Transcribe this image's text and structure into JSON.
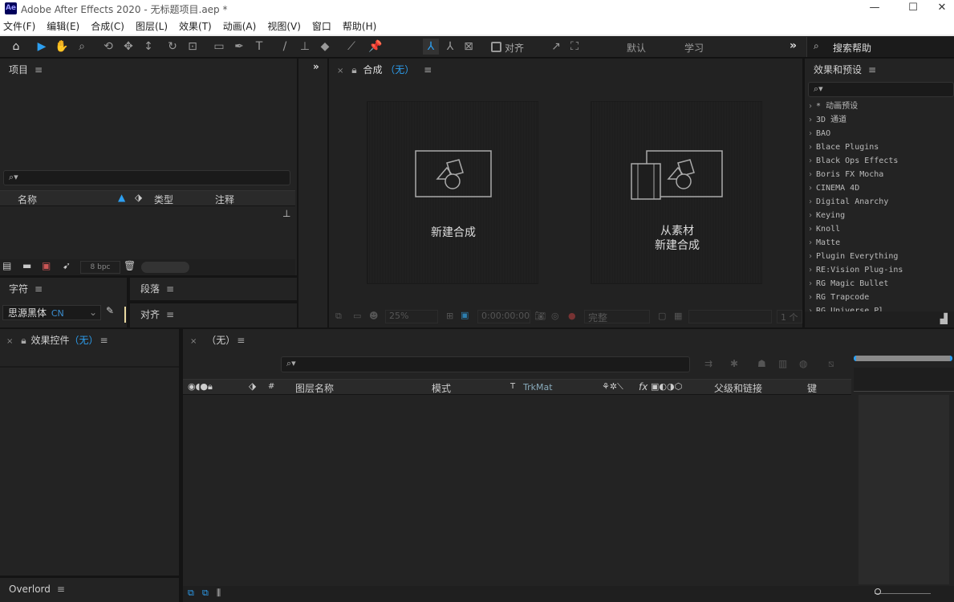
{
  "app": {
    "logo": "Ae",
    "title": "Adobe After Effects 2020 - 无标题项目.aep *",
    "window_controls": [
      "—",
      "☐",
      "✕"
    ]
  },
  "menu": [
    "文件(F)",
    "编辑(E)",
    "合成(C)",
    "图层(L)",
    "效果(T)",
    "动画(A)",
    "视图(V)",
    "窗口",
    "帮助(H)"
  ],
  "toolbar": {
    "snap_label": "对齐",
    "workspaces": [
      "默认",
      "学习"
    ],
    "more": "»",
    "help_search_placeholder": "搜索帮助"
  },
  "project": {
    "title": "项目",
    "columns": [
      "名称",
      "类型",
      "注释"
    ],
    "bpc": "8 bpc"
  },
  "character": {
    "title": "字符",
    "font": "思源黑体",
    "font_suffix": "CN"
  },
  "paragraph": {
    "title": "段落"
  },
  "align": {
    "title": "对齐"
  },
  "composition": {
    "tab_prefix": "合成",
    "tab_name": "（无）",
    "new_comp": "新建合成",
    "from_footage_line1": "从素材",
    "from_footage_line2": "新建合成",
    "zoom": "25%",
    "timecode": "0:00:00:00",
    "resolution": "完整",
    "views": "1 个"
  },
  "effects_presets": {
    "title": "效果和预设",
    "items": [
      "* 动画预设",
      "3D 通道",
      "BAO",
      "Blace Plugins",
      "Black Ops Effects",
      "Boris FX Mocha",
      "CINEMA 4D",
      "Digital Anarchy",
      "Keying",
      "Knoll",
      "Matte",
      "Plugin Everything",
      "RE:Vision Plug-ins",
      "RG Magic Bullet",
      "RG Trapcode",
      "RG Universe Pl..."
    ]
  },
  "effect_controls": {
    "title": "效果控件",
    "name": "（无）"
  },
  "overlord": {
    "title": "Overlord"
  },
  "timeline": {
    "tab": "（无）",
    "columns": {
      "num": "#",
      "layer_name": "图层名称",
      "mode": "模式",
      "t": "T",
      "trkmat": "TrkMat",
      "fx": "fx",
      "parent": "父级和链接",
      "keys": "键"
    }
  }
}
